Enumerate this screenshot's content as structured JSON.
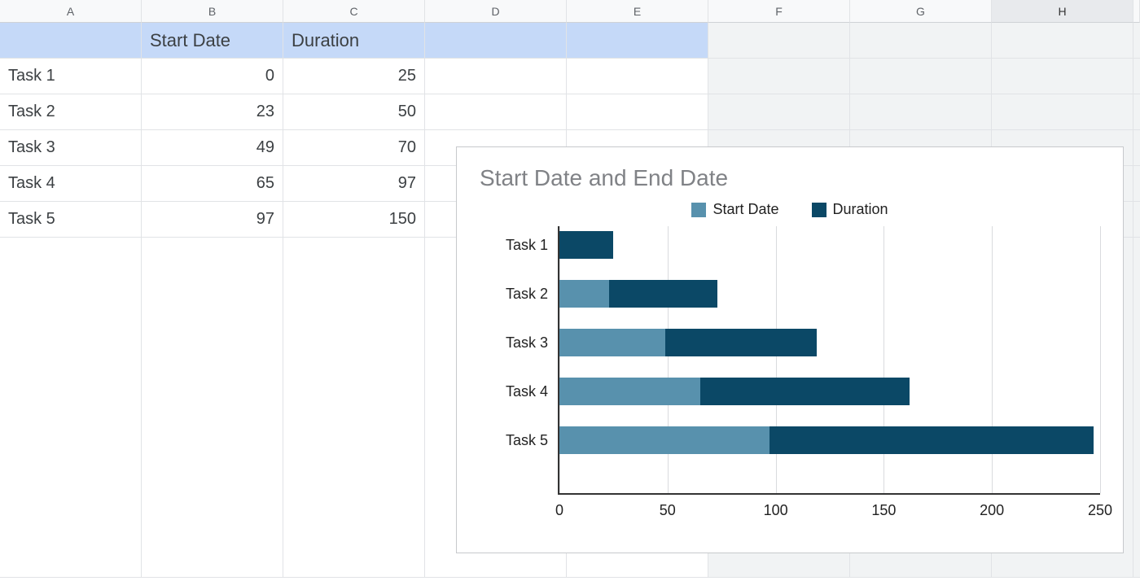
{
  "columns": [
    "A",
    "B",
    "C",
    "D",
    "E",
    "F",
    "G",
    "H"
  ],
  "header_row": {
    "a": "",
    "b": "Start Date",
    "c": "Duration"
  },
  "data_rows": [
    {
      "task": "Task 1",
      "start": "0",
      "duration": "25"
    },
    {
      "task": "Task 2",
      "start": "23",
      "duration": "50"
    },
    {
      "task": "Task 3",
      "start": "49",
      "duration": "70"
    },
    {
      "task": "Task 4",
      "start": "65",
      "duration": "97"
    },
    {
      "task": "Task 5",
      "start": "97",
      "duration": "150"
    }
  ],
  "chart_title": "Start Date and End Date",
  "legend": {
    "start": "Start Date",
    "duration": "Duration"
  },
  "x_ticks": [
    "0",
    "50",
    "100",
    "150",
    "200",
    "250"
  ],
  "chart_data": {
    "type": "bar",
    "orientation": "horizontal",
    "stacked": true,
    "title": "Start Date and End Date",
    "categories": [
      "Task 1",
      "Task 2",
      "Task 3",
      "Task 4",
      "Task 5"
    ],
    "series": [
      {
        "name": "Start Date",
        "values": [
          0,
          23,
          49,
          65,
          97
        ],
        "color": "#5891ad"
      },
      {
        "name": "Duration",
        "values": [
          25,
          50,
          70,
          97,
          150
        ],
        "color": "#0b4866"
      }
    ],
    "xlabel": "",
    "ylabel": "",
    "xlim": [
      0,
      250
    ],
    "x_ticks": [
      0,
      50,
      100,
      150,
      200,
      250
    ],
    "legend_position": "top"
  }
}
